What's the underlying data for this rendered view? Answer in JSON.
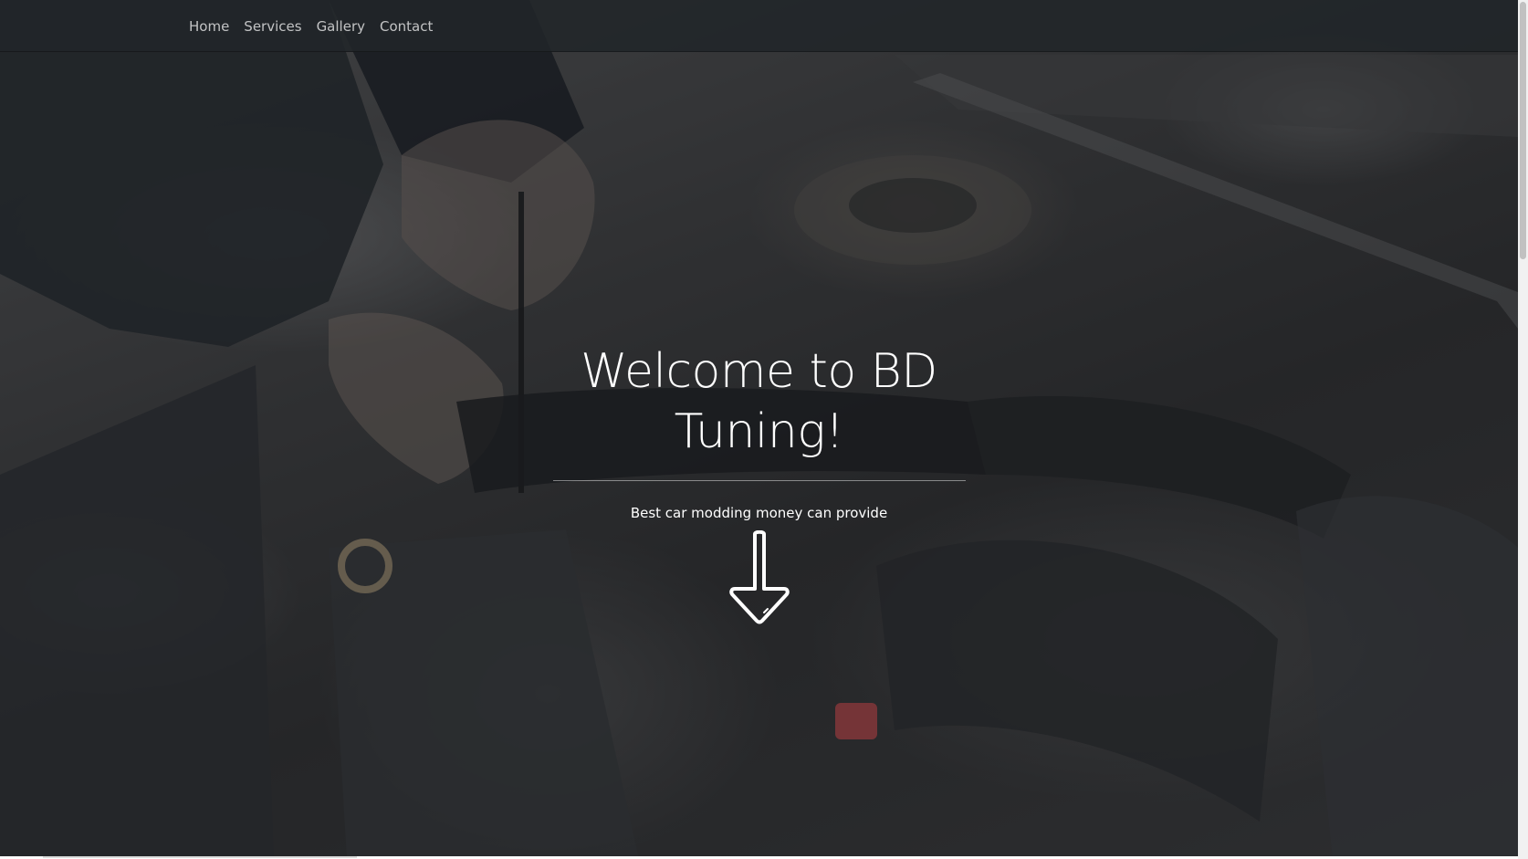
{
  "nav": {
    "items": [
      {
        "label": "Home"
      },
      {
        "label": "Services"
      },
      {
        "label": "Gallery"
      },
      {
        "label": "Contact"
      }
    ]
  },
  "hero": {
    "title": "Welcome to BD Tuning!",
    "tagline": "Best car modding money can provide",
    "scroll_icon": "arrow-down-icon",
    "background_image": "engine-bay-photo"
  },
  "colors": {
    "navbar": "#212529",
    "nav_text": "#c8c9ca",
    "hero_text": "#ffffff"
  }
}
